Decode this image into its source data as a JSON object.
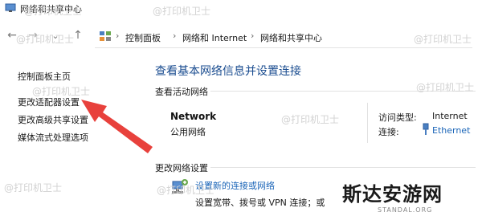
{
  "window": {
    "title": "网络和共享中心"
  },
  "nav": {
    "back": "←",
    "forward": "→",
    "dropdown": "⌄",
    "up": "↑"
  },
  "breadcrumb": {
    "sep": "›",
    "items": [
      "控制面板",
      "网络和 Internet",
      "网络和共享中心"
    ]
  },
  "sidebar": {
    "links": [
      "控制面板主页",
      "更改适配器设置",
      "更改高级共享设置",
      "媒体流式处理选项"
    ]
  },
  "main": {
    "heading": "查看基本网络信息并设置连接",
    "active_label": "查看活动网络",
    "network": {
      "name": "Network",
      "type": "公用网络",
      "access_key": "访问类型:",
      "access_val": "Internet",
      "conn_key": "连接:",
      "conn_val": "Ethernet"
    },
    "change_label": "更改网络设置",
    "setting": {
      "link": "设置新的连接或网络",
      "desc": "设置宽带、拨号或 VPN 连接；或"
    }
  },
  "watermark": {
    "text": "@打印机卫士"
  },
  "logo": {
    "main": "斯达安游网",
    "sub": "STANDAL.ORG"
  },
  "colors": {
    "link": "#1b65b8",
    "heading": "#1b4d90",
    "arrow": "#e8413c"
  },
  "icons": [
    "network-center-icon",
    "control-panel-icon",
    "ethernet-icon",
    "new-connection-icon"
  ]
}
